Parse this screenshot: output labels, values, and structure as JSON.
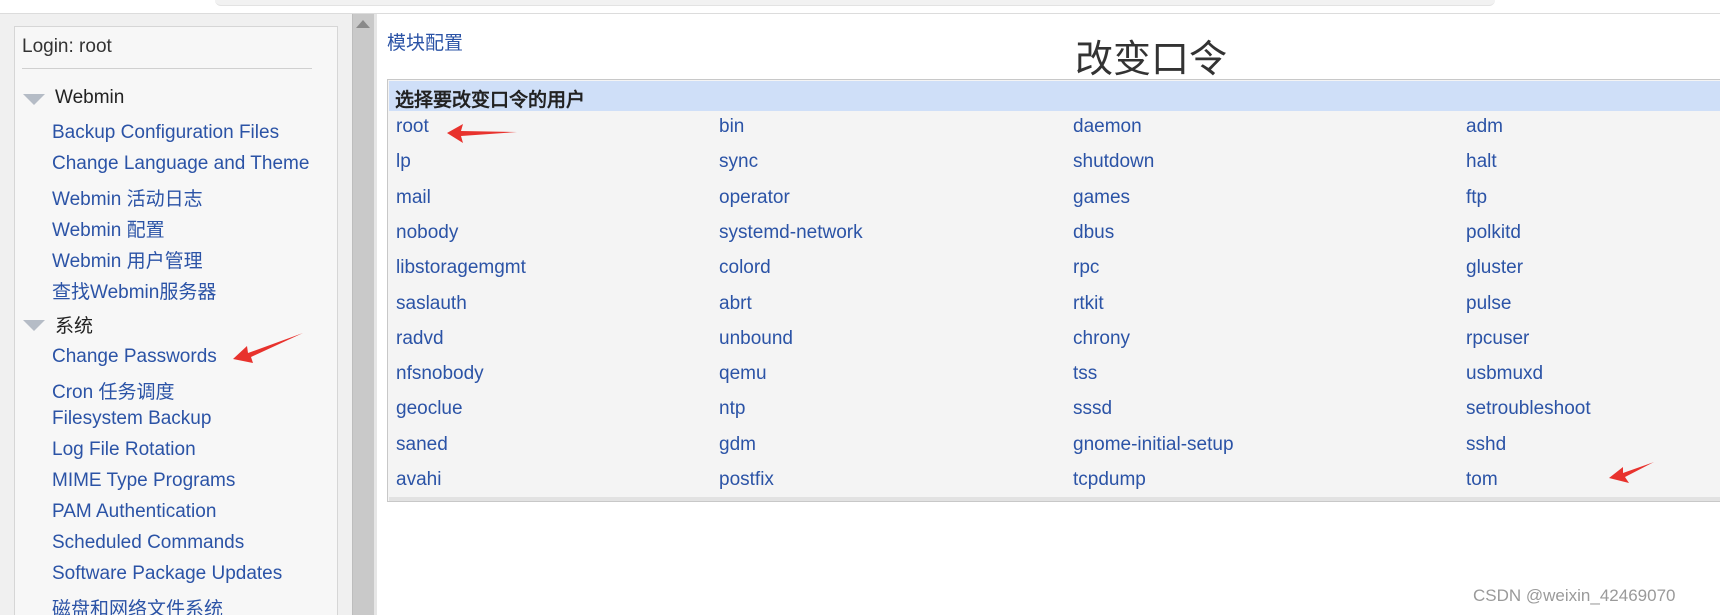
{
  "sidebar": {
    "login": "Login: root",
    "sections": [
      {
        "label": "Webmin",
        "items": [
          "Backup Configuration Files",
          "Change Language and Theme",
          "Webmin 活动日志",
          "Webmin 配置",
          "Webmin 用户管理",
          "查找Webmin服务器"
        ]
      },
      {
        "label": "系统",
        "items": [
          "Change Passwords",
          "Cron 任务调度",
          "Filesystem Backup",
          "Log File Rotation",
          "MIME Type Programs",
          "PAM Authentication",
          "Scheduled Commands",
          "Software Package Updates",
          "磁盘和网络文件系统"
        ]
      }
    ]
  },
  "content": {
    "module_config": "模块配置",
    "title": "改变口令",
    "panel_header": "选择要改变口令的用户",
    "users": [
      [
        "root",
        "bin",
        "daemon",
        "adm"
      ],
      [
        "lp",
        "sync",
        "shutdown",
        "halt"
      ],
      [
        "mail",
        "operator",
        "games",
        "ftp"
      ],
      [
        "nobody",
        "systemd-network",
        "dbus",
        "polkitd"
      ],
      [
        "libstoragemgmt",
        "colord",
        "rpc",
        "gluster"
      ],
      [
        "saslauth",
        "abrt",
        "rtkit",
        "pulse"
      ],
      [
        "radvd",
        "unbound",
        "chrony",
        "rpcuser"
      ],
      [
        "nfsnobody",
        "qemu",
        "tss",
        "usbmuxd"
      ],
      [
        "geoclue",
        "ntp",
        "sssd",
        "setroubleshoot"
      ],
      [
        "saned",
        "gdm",
        "gnome-initial-setup",
        "sshd"
      ],
      [
        "avahi",
        "postfix",
        "tcpdump",
        "tom"
      ]
    ]
  },
  "watermark": "CSDN @weixin_42469070",
  "colors": {
    "link": "#2b53a6",
    "panel_header_bg": "#cfdff8",
    "arrow": "#e8322d"
  }
}
